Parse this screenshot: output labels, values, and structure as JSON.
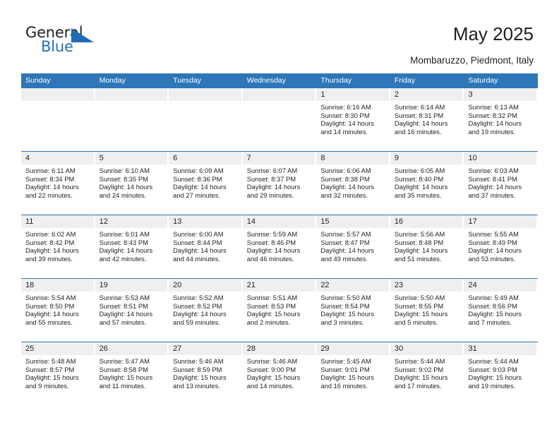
{
  "logo": {
    "word1": "General",
    "word2": "Blue",
    "triangle_color": "#1d6cb5",
    "text_color": "#231f20",
    "blue_color": "#2470b7"
  },
  "header": {
    "title": "May 2025",
    "subtitle": "Mombaruzzo, Piedmont, Italy",
    "header_bg": "#2d76b8",
    "header_text": "#ffffff",
    "daynum_bg": "#efefef"
  },
  "weekdays": [
    "Sunday",
    "Monday",
    "Tuesday",
    "Wednesday",
    "Thursday",
    "Friday",
    "Saturday"
  ],
  "weeks": [
    [
      {
        "day": "",
        "empty": true
      },
      {
        "day": "",
        "empty": true
      },
      {
        "day": "",
        "empty": true
      },
      {
        "day": "",
        "empty": true
      },
      {
        "day": "1",
        "sunrise": "Sunrise: 6:16 AM",
        "sunset": "Sunset: 8:30 PM",
        "daylight1": "Daylight: 14 hours",
        "daylight2": "and 14 minutes."
      },
      {
        "day": "2",
        "sunrise": "Sunrise: 6:14 AM",
        "sunset": "Sunset: 8:31 PM",
        "daylight1": "Daylight: 14 hours",
        "daylight2": "and 16 minutes."
      },
      {
        "day": "3",
        "sunrise": "Sunrise: 6:13 AM",
        "sunset": "Sunset: 8:32 PM",
        "daylight1": "Daylight: 14 hours",
        "daylight2": "and 19 minutes."
      }
    ],
    [
      {
        "day": "4",
        "sunrise": "Sunrise: 6:11 AM",
        "sunset": "Sunset: 8:34 PM",
        "daylight1": "Daylight: 14 hours",
        "daylight2": "and 22 minutes."
      },
      {
        "day": "5",
        "sunrise": "Sunrise: 6:10 AM",
        "sunset": "Sunset: 8:35 PM",
        "daylight1": "Daylight: 14 hours",
        "daylight2": "and 24 minutes."
      },
      {
        "day": "6",
        "sunrise": "Sunrise: 6:09 AM",
        "sunset": "Sunset: 8:36 PM",
        "daylight1": "Daylight: 14 hours",
        "daylight2": "and 27 minutes."
      },
      {
        "day": "7",
        "sunrise": "Sunrise: 6:07 AM",
        "sunset": "Sunset: 8:37 PM",
        "daylight1": "Daylight: 14 hours",
        "daylight2": "and 29 minutes."
      },
      {
        "day": "8",
        "sunrise": "Sunrise: 6:06 AM",
        "sunset": "Sunset: 8:38 PM",
        "daylight1": "Daylight: 14 hours",
        "daylight2": "and 32 minutes."
      },
      {
        "day": "9",
        "sunrise": "Sunrise: 6:05 AM",
        "sunset": "Sunset: 8:40 PM",
        "daylight1": "Daylight: 14 hours",
        "daylight2": "and 35 minutes."
      },
      {
        "day": "10",
        "sunrise": "Sunrise: 6:03 AM",
        "sunset": "Sunset: 8:41 PM",
        "daylight1": "Daylight: 14 hours",
        "daylight2": "and 37 minutes."
      }
    ],
    [
      {
        "day": "11",
        "sunrise": "Sunrise: 6:02 AM",
        "sunset": "Sunset: 8:42 PM",
        "daylight1": "Daylight: 14 hours",
        "daylight2": "and 39 minutes."
      },
      {
        "day": "12",
        "sunrise": "Sunrise: 6:01 AM",
        "sunset": "Sunset: 8:43 PM",
        "daylight1": "Daylight: 14 hours",
        "daylight2": "and 42 minutes."
      },
      {
        "day": "13",
        "sunrise": "Sunrise: 6:00 AM",
        "sunset": "Sunset: 8:44 PM",
        "daylight1": "Daylight: 14 hours",
        "daylight2": "and 44 minutes."
      },
      {
        "day": "14",
        "sunrise": "Sunrise: 5:59 AM",
        "sunset": "Sunset: 8:46 PM",
        "daylight1": "Daylight: 14 hours",
        "daylight2": "and 46 minutes."
      },
      {
        "day": "15",
        "sunrise": "Sunrise: 5:57 AM",
        "sunset": "Sunset: 8:47 PM",
        "daylight1": "Daylight: 14 hours",
        "daylight2": "and 49 minutes."
      },
      {
        "day": "16",
        "sunrise": "Sunrise: 5:56 AM",
        "sunset": "Sunset: 8:48 PM",
        "daylight1": "Daylight: 14 hours",
        "daylight2": "and 51 minutes."
      },
      {
        "day": "17",
        "sunrise": "Sunrise: 5:55 AM",
        "sunset": "Sunset: 8:49 PM",
        "daylight1": "Daylight: 14 hours",
        "daylight2": "and 53 minutes."
      }
    ],
    [
      {
        "day": "18",
        "sunrise": "Sunrise: 5:54 AM",
        "sunset": "Sunset: 8:50 PM",
        "daylight1": "Daylight: 14 hours",
        "daylight2": "and 55 minutes."
      },
      {
        "day": "19",
        "sunrise": "Sunrise: 5:53 AM",
        "sunset": "Sunset: 8:51 PM",
        "daylight1": "Daylight: 14 hours",
        "daylight2": "and 57 minutes."
      },
      {
        "day": "20",
        "sunrise": "Sunrise: 5:52 AM",
        "sunset": "Sunset: 8:52 PM",
        "daylight1": "Daylight: 14 hours",
        "daylight2": "and 59 minutes."
      },
      {
        "day": "21",
        "sunrise": "Sunrise: 5:51 AM",
        "sunset": "Sunset: 8:53 PM",
        "daylight1": "Daylight: 15 hours",
        "daylight2": "and 2 minutes."
      },
      {
        "day": "22",
        "sunrise": "Sunrise: 5:50 AM",
        "sunset": "Sunset: 8:54 PM",
        "daylight1": "Daylight: 15 hours",
        "daylight2": "and 3 minutes."
      },
      {
        "day": "23",
        "sunrise": "Sunrise: 5:50 AM",
        "sunset": "Sunset: 8:55 PM",
        "daylight1": "Daylight: 15 hours",
        "daylight2": "and 5 minutes."
      },
      {
        "day": "24",
        "sunrise": "Sunrise: 5:49 AM",
        "sunset": "Sunset: 8:56 PM",
        "daylight1": "Daylight: 15 hours",
        "daylight2": "and 7 minutes."
      }
    ],
    [
      {
        "day": "25",
        "sunrise": "Sunrise: 5:48 AM",
        "sunset": "Sunset: 8:57 PM",
        "daylight1": "Daylight: 15 hours",
        "daylight2": "and 9 minutes."
      },
      {
        "day": "26",
        "sunrise": "Sunrise: 5:47 AM",
        "sunset": "Sunset: 8:58 PM",
        "daylight1": "Daylight: 15 hours",
        "daylight2": "and 11 minutes."
      },
      {
        "day": "27",
        "sunrise": "Sunrise: 5:46 AM",
        "sunset": "Sunset: 8:59 PM",
        "daylight1": "Daylight: 15 hours",
        "daylight2": "and 13 minutes."
      },
      {
        "day": "28",
        "sunrise": "Sunrise: 5:46 AM",
        "sunset": "Sunset: 9:00 PM",
        "daylight1": "Daylight: 15 hours",
        "daylight2": "and 14 minutes."
      },
      {
        "day": "29",
        "sunrise": "Sunrise: 5:45 AM",
        "sunset": "Sunset: 9:01 PM",
        "daylight1": "Daylight: 15 hours",
        "daylight2": "and 16 minutes."
      },
      {
        "day": "30",
        "sunrise": "Sunrise: 5:44 AM",
        "sunset": "Sunset: 9:02 PM",
        "daylight1": "Daylight: 15 hours",
        "daylight2": "and 17 minutes."
      },
      {
        "day": "31",
        "sunrise": "Sunrise: 5:44 AM",
        "sunset": "Sunset: 9:03 PM",
        "daylight1": "Daylight: 15 hours",
        "daylight2": "and 19 minutes."
      }
    ]
  ]
}
